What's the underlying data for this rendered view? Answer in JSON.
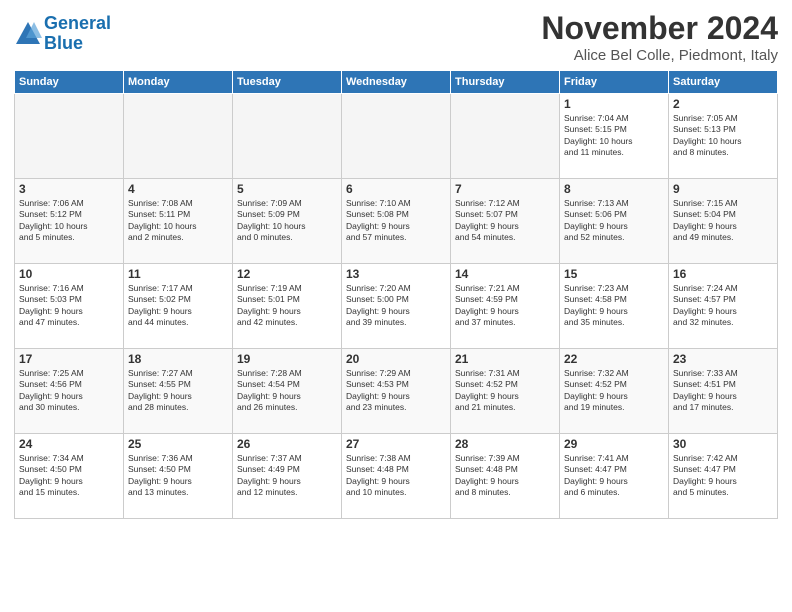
{
  "header": {
    "logo_line1": "General",
    "logo_line2": "Blue",
    "month_title": "November 2024",
    "location": "Alice Bel Colle, Piedmont, Italy"
  },
  "weekdays": [
    "Sunday",
    "Monday",
    "Tuesday",
    "Wednesday",
    "Thursday",
    "Friday",
    "Saturday"
  ],
  "weeks": [
    [
      {
        "day": "",
        "info": ""
      },
      {
        "day": "",
        "info": ""
      },
      {
        "day": "",
        "info": ""
      },
      {
        "day": "",
        "info": ""
      },
      {
        "day": "",
        "info": ""
      },
      {
        "day": "1",
        "info": "Sunrise: 7:04 AM\nSunset: 5:15 PM\nDaylight: 10 hours\nand 11 minutes."
      },
      {
        "day": "2",
        "info": "Sunrise: 7:05 AM\nSunset: 5:13 PM\nDaylight: 10 hours\nand 8 minutes."
      }
    ],
    [
      {
        "day": "3",
        "info": "Sunrise: 7:06 AM\nSunset: 5:12 PM\nDaylight: 10 hours\nand 5 minutes."
      },
      {
        "day": "4",
        "info": "Sunrise: 7:08 AM\nSunset: 5:11 PM\nDaylight: 10 hours\nand 2 minutes."
      },
      {
        "day": "5",
        "info": "Sunrise: 7:09 AM\nSunset: 5:09 PM\nDaylight: 10 hours\nand 0 minutes."
      },
      {
        "day": "6",
        "info": "Sunrise: 7:10 AM\nSunset: 5:08 PM\nDaylight: 9 hours\nand 57 minutes."
      },
      {
        "day": "7",
        "info": "Sunrise: 7:12 AM\nSunset: 5:07 PM\nDaylight: 9 hours\nand 54 minutes."
      },
      {
        "day": "8",
        "info": "Sunrise: 7:13 AM\nSunset: 5:06 PM\nDaylight: 9 hours\nand 52 minutes."
      },
      {
        "day": "9",
        "info": "Sunrise: 7:15 AM\nSunset: 5:04 PM\nDaylight: 9 hours\nand 49 minutes."
      }
    ],
    [
      {
        "day": "10",
        "info": "Sunrise: 7:16 AM\nSunset: 5:03 PM\nDaylight: 9 hours\nand 47 minutes."
      },
      {
        "day": "11",
        "info": "Sunrise: 7:17 AM\nSunset: 5:02 PM\nDaylight: 9 hours\nand 44 minutes."
      },
      {
        "day": "12",
        "info": "Sunrise: 7:19 AM\nSunset: 5:01 PM\nDaylight: 9 hours\nand 42 minutes."
      },
      {
        "day": "13",
        "info": "Sunrise: 7:20 AM\nSunset: 5:00 PM\nDaylight: 9 hours\nand 39 minutes."
      },
      {
        "day": "14",
        "info": "Sunrise: 7:21 AM\nSunset: 4:59 PM\nDaylight: 9 hours\nand 37 minutes."
      },
      {
        "day": "15",
        "info": "Sunrise: 7:23 AM\nSunset: 4:58 PM\nDaylight: 9 hours\nand 35 minutes."
      },
      {
        "day": "16",
        "info": "Sunrise: 7:24 AM\nSunset: 4:57 PM\nDaylight: 9 hours\nand 32 minutes."
      }
    ],
    [
      {
        "day": "17",
        "info": "Sunrise: 7:25 AM\nSunset: 4:56 PM\nDaylight: 9 hours\nand 30 minutes."
      },
      {
        "day": "18",
        "info": "Sunrise: 7:27 AM\nSunset: 4:55 PM\nDaylight: 9 hours\nand 28 minutes."
      },
      {
        "day": "19",
        "info": "Sunrise: 7:28 AM\nSunset: 4:54 PM\nDaylight: 9 hours\nand 26 minutes."
      },
      {
        "day": "20",
        "info": "Sunrise: 7:29 AM\nSunset: 4:53 PM\nDaylight: 9 hours\nand 23 minutes."
      },
      {
        "day": "21",
        "info": "Sunrise: 7:31 AM\nSunset: 4:52 PM\nDaylight: 9 hours\nand 21 minutes."
      },
      {
        "day": "22",
        "info": "Sunrise: 7:32 AM\nSunset: 4:52 PM\nDaylight: 9 hours\nand 19 minutes."
      },
      {
        "day": "23",
        "info": "Sunrise: 7:33 AM\nSunset: 4:51 PM\nDaylight: 9 hours\nand 17 minutes."
      }
    ],
    [
      {
        "day": "24",
        "info": "Sunrise: 7:34 AM\nSunset: 4:50 PM\nDaylight: 9 hours\nand 15 minutes."
      },
      {
        "day": "25",
        "info": "Sunrise: 7:36 AM\nSunset: 4:50 PM\nDaylight: 9 hours\nand 13 minutes."
      },
      {
        "day": "26",
        "info": "Sunrise: 7:37 AM\nSunset: 4:49 PM\nDaylight: 9 hours\nand 12 minutes."
      },
      {
        "day": "27",
        "info": "Sunrise: 7:38 AM\nSunset: 4:48 PM\nDaylight: 9 hours\nand 10 minutes."
      },
      {
        "day": "28",
        "info": "Sunrise: 7:39 AM\nSunset: 4:48 PM\nDaylight: 9 hours\nand 8 minutes."
      },
      {
        "day": "29",
        "info": "Sunrise: 7:41 AM\nSunset: 4:47 PM\nDaylight: 9 hours\nand 6 minutes."
      },
      {
        "day": "30",
        "info": "Sunrise: 7:42 AM\nSunset: 4:47 PM\nDaylight: 9 hours\nand 5 minutes."
      }
    ]
  ]
}
